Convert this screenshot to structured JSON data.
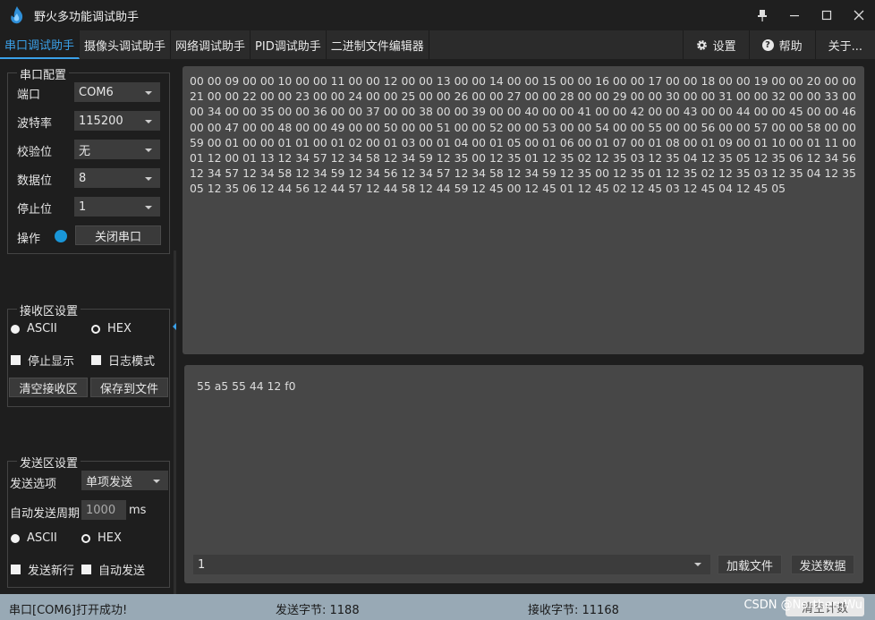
{
  "app": {
    "title": "野火多功能调试助手"
  },
  "window_controls": {
    "pin": "📌",
    "minimize": "—",
    "maximize": "☐",
    "close": "✕"
  },
  "tabs": [
    {
      "label": "串口调试助手",
      "active": true
    },
    {
      "label": "摄像头调试助手"
    },
    {
      "label": "网络调试助手"
    },
    {
      "label": "PID调试助手"
    },
    {
      "label": "二进制文件编辑器"
    }
  ],
  "toolbar_right": {
    "settings": "设置",
    "help": "帮助",
    "about": "关于..."
  },
  "serial_config": {
    "title": "串口配置",
    "port_label": "端口",
    "port_value": "COM6",
    "baud_label": "波特率",
    "baud_value": "115200",
    "parity_label": "校验位",
    "parity_value": "无",
    "databits_label": "数据位",
    "databits_value": "8",
    "stopbits_label": "停止位",
    "stopbits_value": "1",
    "op_label": "操作",
    "close_button": "关闭串口"
  },
  "recv_settings": {
    "title": "接收区设置",
    "ascii": "ASCII",
    "hex": "HEX",
    "stop_display": "停止显示",
    "log_mode": "日志模式",
    "clear_button": "清空接收区",
    "save_button": "保存到文件"
  },
  "send_settings": {
    "title": "发送区设置",
    "option_label": "发送选项",
    "option_value": "单项发送",
    "period_label": "自动发送周期",
    "period_value": "1000",
    "period_unit": "ms",
    "ascii": "ASCII",
    "hex": "HEX",
    "newline": "发送新行",
    "auto_send": "自动发送"
  },
  "receive_area": {
    "text": "00 00 09 00 00 10 00 00 11 00 00 12 00 00 13 00 00 14 00 00 15 00 00 16 00 00 17 00 00 18 00 00 19 00 00 20 00 00 21 00 00 22 00 00 23 00 00 24 00 00 25 00 00 26 00 00 27 00 00 28 00 00 29 00 00 30 00 00 31 00 00 32 00 00 33 00 00 34 00 00 35 00 00 36 00 00 37 00 00 38 00 00 39 00 00 40 00 00 41 00 00 42 00 00 43 00 00 44 00 00 45 00 00 46 00 00 47 00 00 48 00 00 49 00 00 50 00 00 51 00 00 52 00 00 53 00 00 54 00 00 55 00 00 56 00 00 57 00 00 58 00 00 59 00 01 00 00 01 01 00 01 02 00 01 03 00 01 04 00 01 05 00 01 06 00 01 07 00 01 08 00 01 09 00 01 10 00 01 11 00 01 12 00 01 13 12 34 57 12 34 58 12 34 59 12 35 00 12 35 01 12 35 02 12 35 03 12 35 04 12 35 05 12 35 06 12 34 56 12 34 57 12 34 58 12 34 59 12 34 56 12 34 57 12 34 58 12 34 59 12 35 00 12 35 01 12 35 02 12 35 03 12 35 04 12 35 05 12 35 06 12 44 56 12 44 57 12 44 58 12 44 59 12 45 00 12 45 01 12 45 02 12 45 03 12 45 04 12 45 05"
  },
  "send_area": {
    "text": "55 a5 55 44 12 f0",
    "history_value": "1",
    "load_button": "加载文件",
    "send_button": "发送数据"
  },
  "status": {
    "message": "串口[COM6]打开成功!",
    "sent": "发送字节: 1188",
    "received": "接收字节: 11168",
    "watermark": "CSDN @NorthernWu",
    "clear_count": "清空计数"
  },
  "colors": {
    "accent": "#3aa0e8",
    "led": "#1996d8",
    "statusbar": "#98a9b5"
  }
}
